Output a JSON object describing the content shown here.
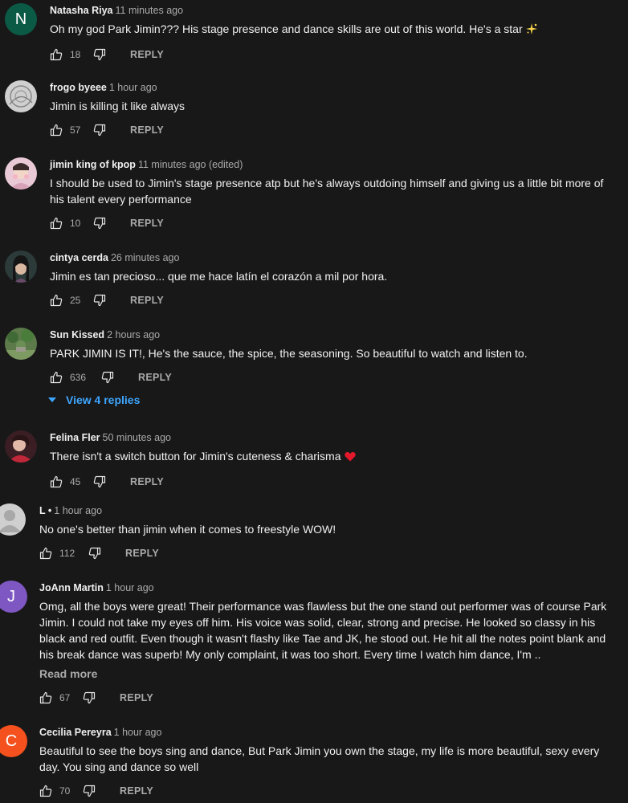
{
  "reply_label": "REPLY",
  "comments": [
    {
      "author": "Natasha Riya",
      "time": "11 minutes ago",
      "text": "Oh my god Park Jimin??? His stage presence and dance skills are out of this world. He's a star",
      "likes": "18",
      "avatar_letter": "N",
      "avatar_color": "#0b5a45"
    },
    {
      "author": "frogo byeee",
      "time": "1 hour ago",
      "text": "Jimin is killing it like always",
      "likes": "57"
    },
    {
      "author": "jimin king of kpop",
      "time": "11 minutes ago (edited)",
      "text": "I should be used to Jimin's stage presence atp but he's always outdoing himself and giving us a little bit more of his talent every performance",
      "likes": "10"
    },
    {
      "author": "cintya cerda",
      "time": "26 minutes ago",
      "text": "Jimin es tan precioso... que me hace latín el corazón a mil por hora.",
      "likes": "25"
    },
    {
      "author": "Sun Kissed",
      "time": "2 hours ago",
      "text": "PARK JIMIN IS IT!, He's the sauce, the spice, the seasoning. So beautiful to watch and listen to.",
      "likes": "636",
      "view_replies": "View 4 replies"
    },
    {
      "author": "Felina Fler",
      "time": "50 minutes ago",
      "text": "There isn't a switch button for Jimin's cuteness & charisma",
      "likes": "45"
    },
    {
      "author": "L •",
      "time": "1 hour ago",
      "text": "No one's better than jimin when it comes to freestyle WOW!",
      "likes": "112"
    },
    {
      "author": "JoAnn Martin",
      "time": "1 hour ago",
      "text": "Omg, all the boys were great! Their performance was flawless but the one stand out performer was of course Park Jimin. I could not take my eyes off him. His voice was solid, clear, strong and precise. He looked so classy in his black and red outfit. Even though it wasn't flashy like Tae and JK, he stood out. He hit all the notes point blank and his break dance was superb! My only complaint, it was too short. Every time I watch him dance, I'm ..",
      "read_more": "Read more",
      "likes": "67",
      "avatar_letter": "J",
      "avatar_color": "#7e57c2"
    },
    {
      "author": "Cecilia Pereyra",
      "time": "1 hour ago",
      "text": "Beautiful to see the boys sing and dance, But Park Jimin you own the stage, my life is more beautiful, sexy every day.  You sing and dance so well",
      "likes": "70",
      "avatar_letter": "C",
      "avatar_color": "#f4511e"
    }
  ]
}
